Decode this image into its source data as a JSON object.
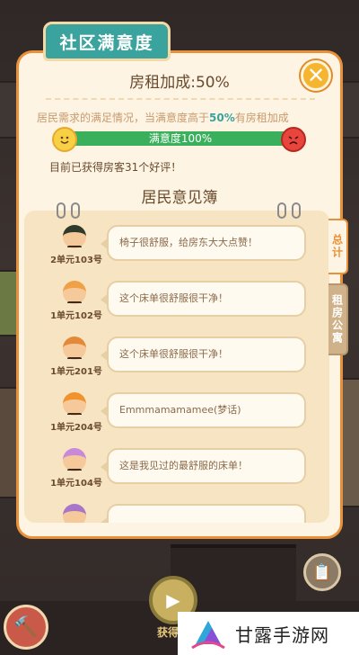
{
  "panel": {
    "tab_title": "社区满意度",
    "close_label": "✕",
    "rent_title": "房租加成:50%",
    "description_before": "居民需求的满足情况，当满意度高于",
    "description_highlight": "50%",
    "description_after": "有房租加成",
    "satisfaction": {
      "label": "满意度100%",
      "value_fraction": 1.0,
      "color_good": "#3bb05c"
    },
    "praise_count_text": "目前已获得房客31个好评！",
    "book_title": "居民意见簿"
  },
  "comments": [
    {
      "unit": "2单元103号",
      "text": "椅子很舒服，给房东大大点赞！",
      "hair": "#2f3a2a",
      "accent": "#d9e36a"
    },
    {
      "unit": "1单元102号",
      "text": "这个床单很舒服很干净！",
      "hair": "#f0a046",
      "accent": "#f0a046"
    },
    {
      "unit": "1单元201号",
      "text": "这个床单很舒服很干净！",
      "hair": "#e38a3a",
      "accent": "#e38a3a"
    },
    {
      "unit": "1单元204号",
      "text": "Emmmamamamee(梦话)",
      "hair": "#f0922e",
      "accent": "#f0922e"
    },
    {
      "unit": "1单元104号",
      "text": "这是我见过的最舒服的床单！",
      "hair": "#c88ad8",
      "accent": "#c88ad8"
    },
    {
      "unit": "",
      "text": "",
      "hair": "#a876c8",
      "accent": "#a876c8"
    }
  ],
  "side_tabs": [
    {
      "label": "总计",
      "active": true
    },
    {
      "label": "租房公寓",
      "active": false
    }
  ],
  "bottom": {
    "mid_label": "获得加",
    "tool_icon": "clipboard-icon",
    "hammer_icon": "hammer-icon"
  },
  "watermark": {
    "text": "甘露手游网"
  }
}
